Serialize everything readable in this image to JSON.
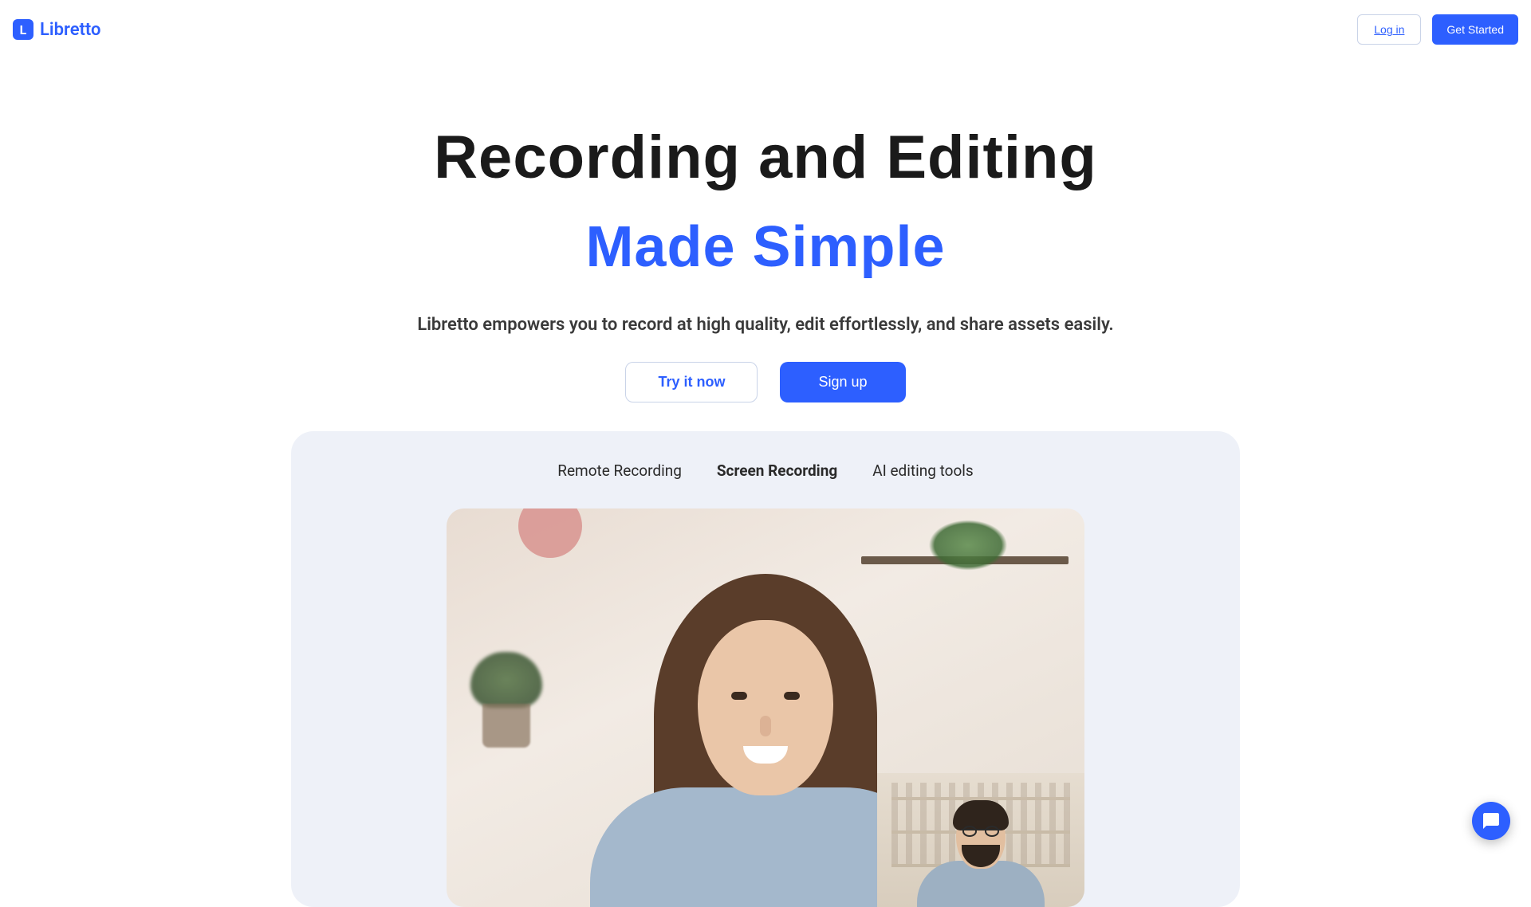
{
  "brand": {
    "name": "Libretto",
    "logo_letter": "L"
  },
  "header": {
    "login": "Log in",
    "get_started": "Get Started"
  },
  "hero": {
    "title": "Recording and Editing",
    "subtitle": "Made Simple",
    "description": "Libretto empowers you to record at high quality, edit effortlessly, and share assets easily.",
    "try_now": "Try it now",
    "sign_up": "Sign up"
  },
  "tabs": {
    "items": [
      {
        "label": "Remote Recording",
        "active": false
      },
      {
        "label": "Screen Recording",
        "active": true
      },
      {
        "label": "AI editing tools",
        "active": false
      }
    ]
  },
  "colors": {
    "primary": "#2d5fff",
    "panel_bg": "#eef1f8"
  }
}
